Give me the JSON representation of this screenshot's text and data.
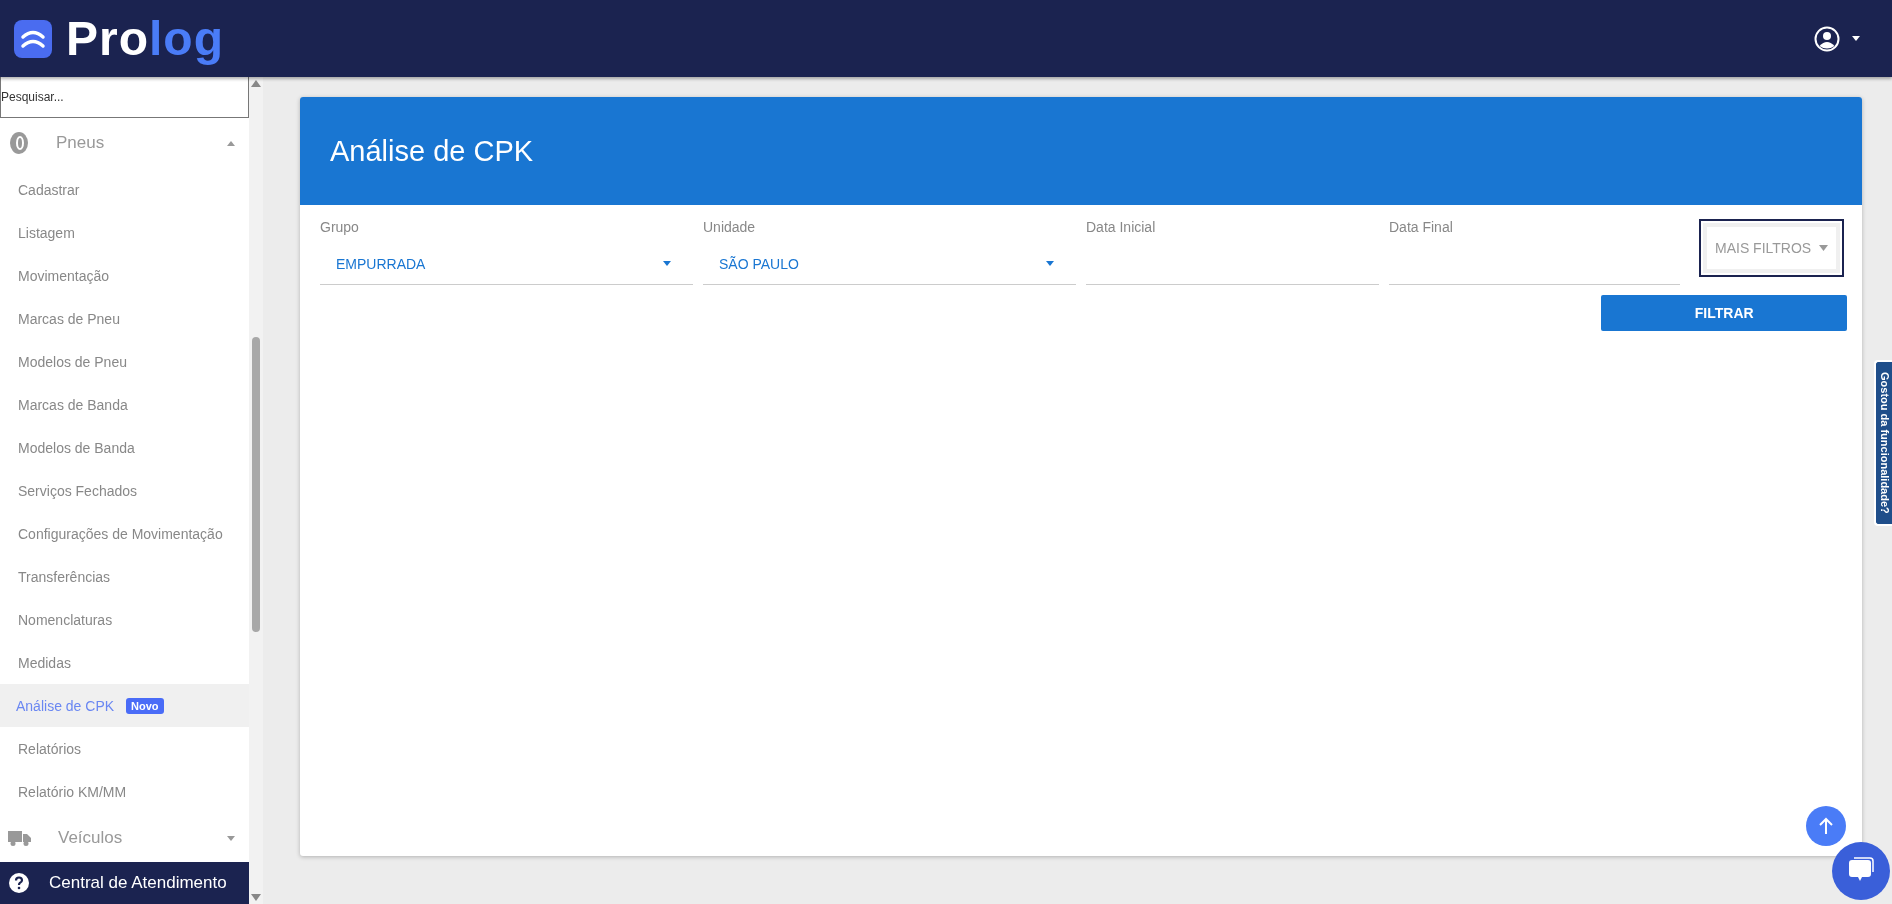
{
  "header": {
    "logo": {
      "part_1": "Pro",
      "part_2": "log"
    }
  },
  "sidebar": {
    "search": {
      "placeholder": "Pesquisar..."
    },
    "groups": [
      {
        "label": "Pneus",
        "kind": "tire",
        "expanded": true,
        "children": [
          {
            "label": "Cadastrar",
            "selected": false
          },
          {
            "label": "Listagem",
            "selected": false
          },
          {
            "label": "Movimentação",
            "selected": false
          },
          {
            "label": "Marcas de Pneu",
            "selected": false
          },
          {
            "label": "Modelos de Pneu",
            "selected": false
          },
          {
            "label": "Marcas de Banda",
            "selected": false
          },
          {
            "label": "Modelos de Banda",
            "selected": false
          },
          {
            "label": "Serviços Fechados",
            "selected": false
          },
          {
            "label": "Configurações de Movimentação",
            "selected": false
          },
          {
            "label": "Transferências",
            "selected": false
          },
          {
            "label": "Nomenclaturas",
            "selected": false
          },
          {
            "label": "Medidas",
            "selected": false
          },
          {
            "label": "Análise de CPK",
            "selected": true,
            "badge": "Novo"
          },
          {
            "label": "Relatórios",
            "selected": false
          },
          {
            "label": "Relatório KM/MM",
            "selected": false
          }
        ]
      },
      {
        "label": "Veículos",
        "kind": "truck",
        "expanded": false
      }
    ],
    "footer": "Central de Atendimento"
  },
  "page": {
    "title": "Análise de CPK",
    "filters": [
      {
        "label": "Grupo",
        "kind": "select",
        "value": "EMPURRADA"
      },
      {
        "label": "Unidade",
        "kind": "select",
        "value": "SÃO PAULO"
      },
      {
        "label": "Data Inicial",
        "kind": "date"
      },
      {
        "label": "Data Final",
        "kind": "date"
      }
    ],
    "more_filters": "MAIS FILTROS",
    "submit": "FILTRAR"
  },
  "feedback_tab": "Gostou da funcionalidade?"
}
